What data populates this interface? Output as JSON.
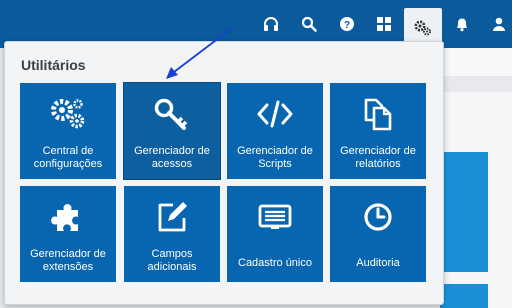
{
  "topbar": {
    "icons": [
      "headset-icon",
      "search-icon",
      "help-icon",
      "grid-icon",
      "gears-icon",
      "bell-icon",
      "user-icon"
    ],
    "active_icon": "gears-icon"
  },
  "popup": {
    "title": "Utilitários",
    "tiles": [
      {
        "icon": "gears-icon",
        "line1": "Central de",
        "line2": "configurações"
      },
      {
        "icon": "key-icon",
        "line1": "Gerenciador de",
        "line2": "acessos"
      },
      {
        "icon": "code-icon",
        "line1": "Gerenciador de",
        "line2": "Scripts"
      },
      {
        "icon": "copy-icon",
        "line1": "Gerenciador de",
        "line2": "relatórios"
      },
      {
        "icon": "puzzle-icon",
        "line1": "Gerenciador de",
        "line2": "extensões"
      },
      {
        "icon": "edit-icon",
        "line1": "Campos",
        "line2": "adicionais"
      },
      {
        "icon": "id-card-icon",
        "line1": "Cadastro único",
        "line2": ""
      },
      {
        "icon": "clock-icon",
        "line1": "Auditoria",
        "line2": ""
      }
    ]
  },
  "colors": {
    "topbar": "#0a5a9c",
    "tile": "#0866b0",
    "annotation_arrow": "#1a3fd6"
  }
}
